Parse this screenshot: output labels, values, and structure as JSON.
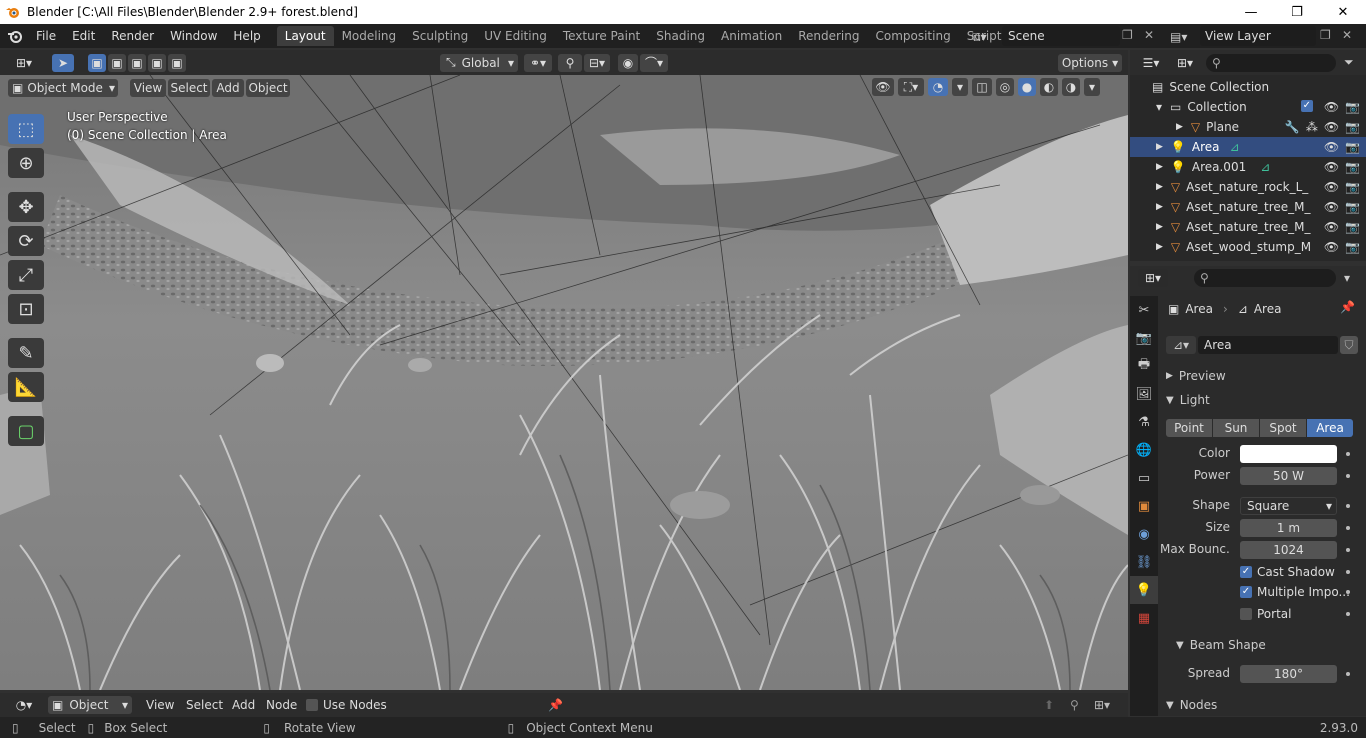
{
  "window": {
    "title": "Blender [C:\\All Files\\Blender\\Blender 2.9+ forest.blend]",
    "minimize": "—",
    "maximize": "❐",
    "close": "✕"
  },
  "menubar": {
    "items": [
      "File",
      "Edit",
      "Render",
      "Window",
      "Help"
    ]
  },
  "workspaces": {
    "tabs": [
      "Layout",
      "Modeling",
      "Sculpting",
      "UV Editing",
      "Texture Paint",
      "Shading",
      "Animation",
      "Rendering",
      "Compositing",
      "Scripting"
    ],
    "active": "Layout"
  },
  "scene": {
    "name": "Scene"
  },
  "view_layer": {
    "name": "View Layer"
  },
  "viewport_header": {
    "transform_orientation": "Global",
    "options": "Options",
    "mode": "Object Mode",
    "menus": [
      "View",
      "Select",
      "Add",
      "Object"
    ]
  },
  "viewport": {
    "perspective": "User Perspective",
    "collection_info": "(0) Scene Collection | Area"
  },
  "outliner": {
    "root": "Scene Collection",
    "collection": "Collection",
    "rows": [
      {
        "name": "Plane",
        "type": "mesh"
      },
      {
        "name": "Area",
        "type": "light",
        "selected": true
      },
      {
        "name": "Area.001",
        "type": "light"
      },
      {
        "name": "Aset_nature_rock_L_",
        "type": "mesh"
      },
      {
        "name": "Aset_nature_tree_M_",
        "type": "mesh"
      },
      {
        "name": "Aset_nature_tree_M_",
        "type": "mesh"
      },
      {
        "name": "Aset_wood_stump_M",
        "type": "mesh"
      }
    ]
  },
  "properties": {
    "breadcrumb_object": "Area",
    "breadcrumb_data": "Area",
    "datablock_name": "Area",
    "preview_panel": "Preview",
    "light_panel": "Light",
    "light_types": [
      "Point",
      "Sun",
      "Spot",
      "Area"
    ],
    "active_light_type": "Area",
    "color_label": "Color",
    "power_label": "Power",
    "power_value": "50 W",
    "shape_label": "Shape",
    "shape_value": "Square",
    "size_label": "Size",
    "size_value": "1 m",
    "max_bounces_label": "Max Bounc...",
    "max_bounces_value": "1024",
    "cast_shadow": "Cast Shadow",
    "multiple_importance": "Multiple Impo...",
    "portal": "Portal",
    "beam_shape_panel": "Beam Shape",
    "spread_label": "Spread",
    "spread_value": "180°",
    "nodes_panel": "Nodes"
  },
  "bottom_header": {
    "editor_type": "Object",
    "menus": [
      "View",
      "Select",
      "Add",
      "Node"
    ],
    "use_nodes": "Use Nodes"
  },
  "statusbar": {
    "select": "Select",
    "box_select": "Box Select",
    "rotate_view": "Rotate View",
    "context_menu": "Object Context Menu",
    "version": "2.93.0"
  },
  "colors": {
    "accent_blue": "#4772b3",
    "light_orange": "#e08a3c",
    "selected_row": "#334d80",
    "data_green": "#3fbf9a"
  }
}
